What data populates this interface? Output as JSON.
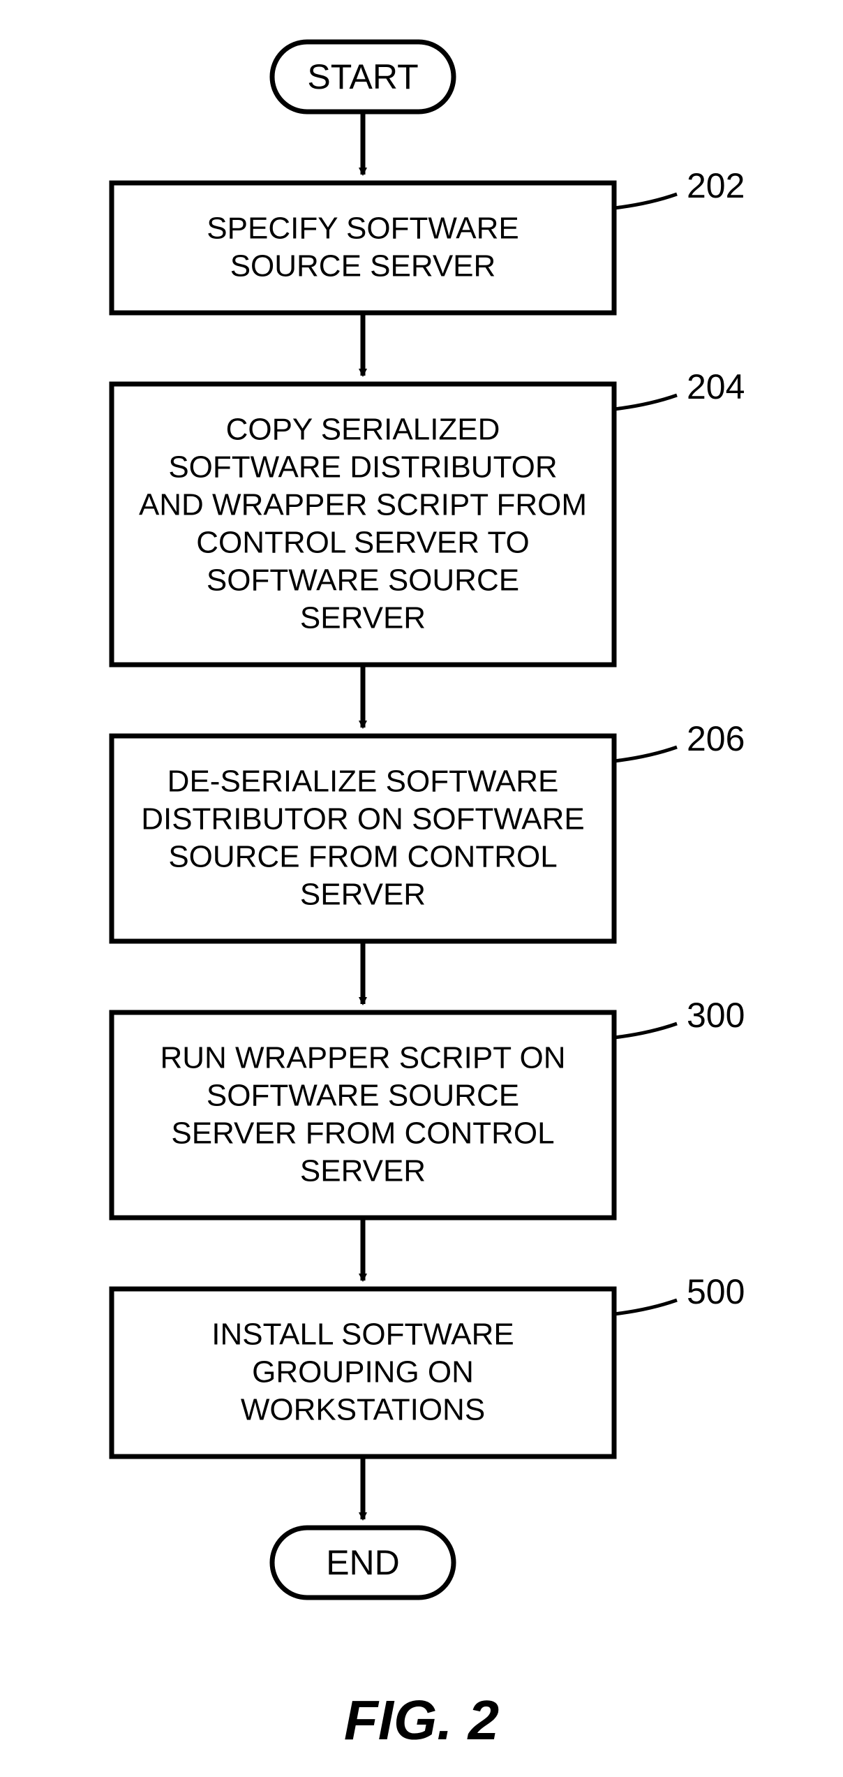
{
  "terminals": {
    "start": "START",
    "end": "END"
  },
  "figureLabel": "FIG. 2",
  "steps": [
    {
      "id": "202",
      "label": "202",
      "lines": [
        "SPECIFY SOFTWARE",
        "SOURCE SERVER"
      ]
    },
    {
      "id": "204",
      "label": "204",
      "lines": [
        "COPY SERIALIZED",
        "SOFTWARE DISTRIBUTOR",
        "AND WRAPPER SCRIPT FROM",
        "CONTROL SERVER TO",
        "SOFTWARE SOURCE",
        "SERVER"
      ]
    },
    {
      "id": "206",
      "label": "206",
      "lines": [
        "DE-SERIALIZE SOFTWARE",
        "DISTRIBUTOR ON SOFTWARE",
        "SOURCE FROM CONTROL",
        "SERVER"
      ]
    },
    {
      "id": "300",
      "label": "300",
      "lines": [
        "RUN WRAPPER SCRIPT ON",
        "SOFTWARE SOURCE",
        "SERVER FROM CONTROL",
        "SERVER"
      ]
    },
    {
      "id": "500",
      "label": "500",
      "lines": [
        "INSTALL SOFTWARE",
        "GROUPING ON",
        "WORKSTATIONS"
      ]
    }
  ]
}
